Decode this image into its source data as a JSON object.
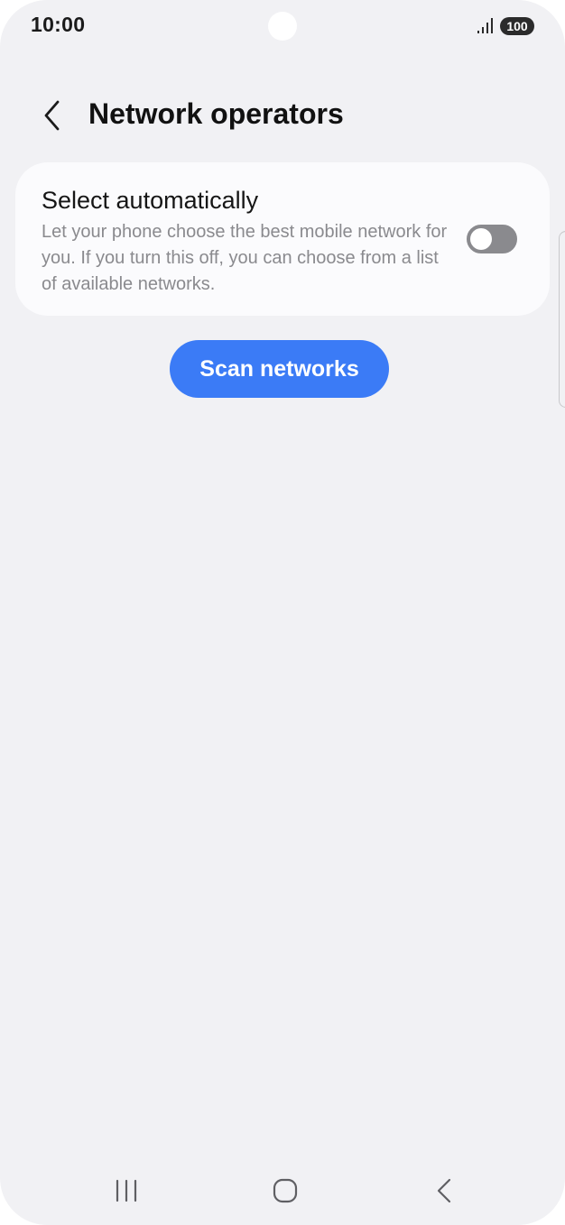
{
  "status_bar": {
    "time": "10:00",
    "battery": "100",
    "signal_icon": "signal-bars-icon"
  },
  "header": {
    "back_icon": "chevron-left-icon",
    "title": "Network operators"
  },
  "settings": {
    "select_automatically": {
      "title": "Select automatically",
      "description": "Let your phone choose the best mobile network for you. If you turn this off, you can choose from a list of available networks.",
      "enabled": false
    }
  },
  "actions": {
    "scan_label": "Scan networks"
  },
  "nav_bar": {
    "recents_icon": "recents-lines-icon",
    "home_icon": "home-rounded-square-icon",
    "back_icon": "back-chevron-icon"
  },
  "colors": {
    "background": "#f1f1f4",
    "card": "#fbfbfd",
    "accent": "#3b7bf6",
    "toggle_off": "#8a8a8e",
    "secondary_text": "#8a8a8e"
  }
}
